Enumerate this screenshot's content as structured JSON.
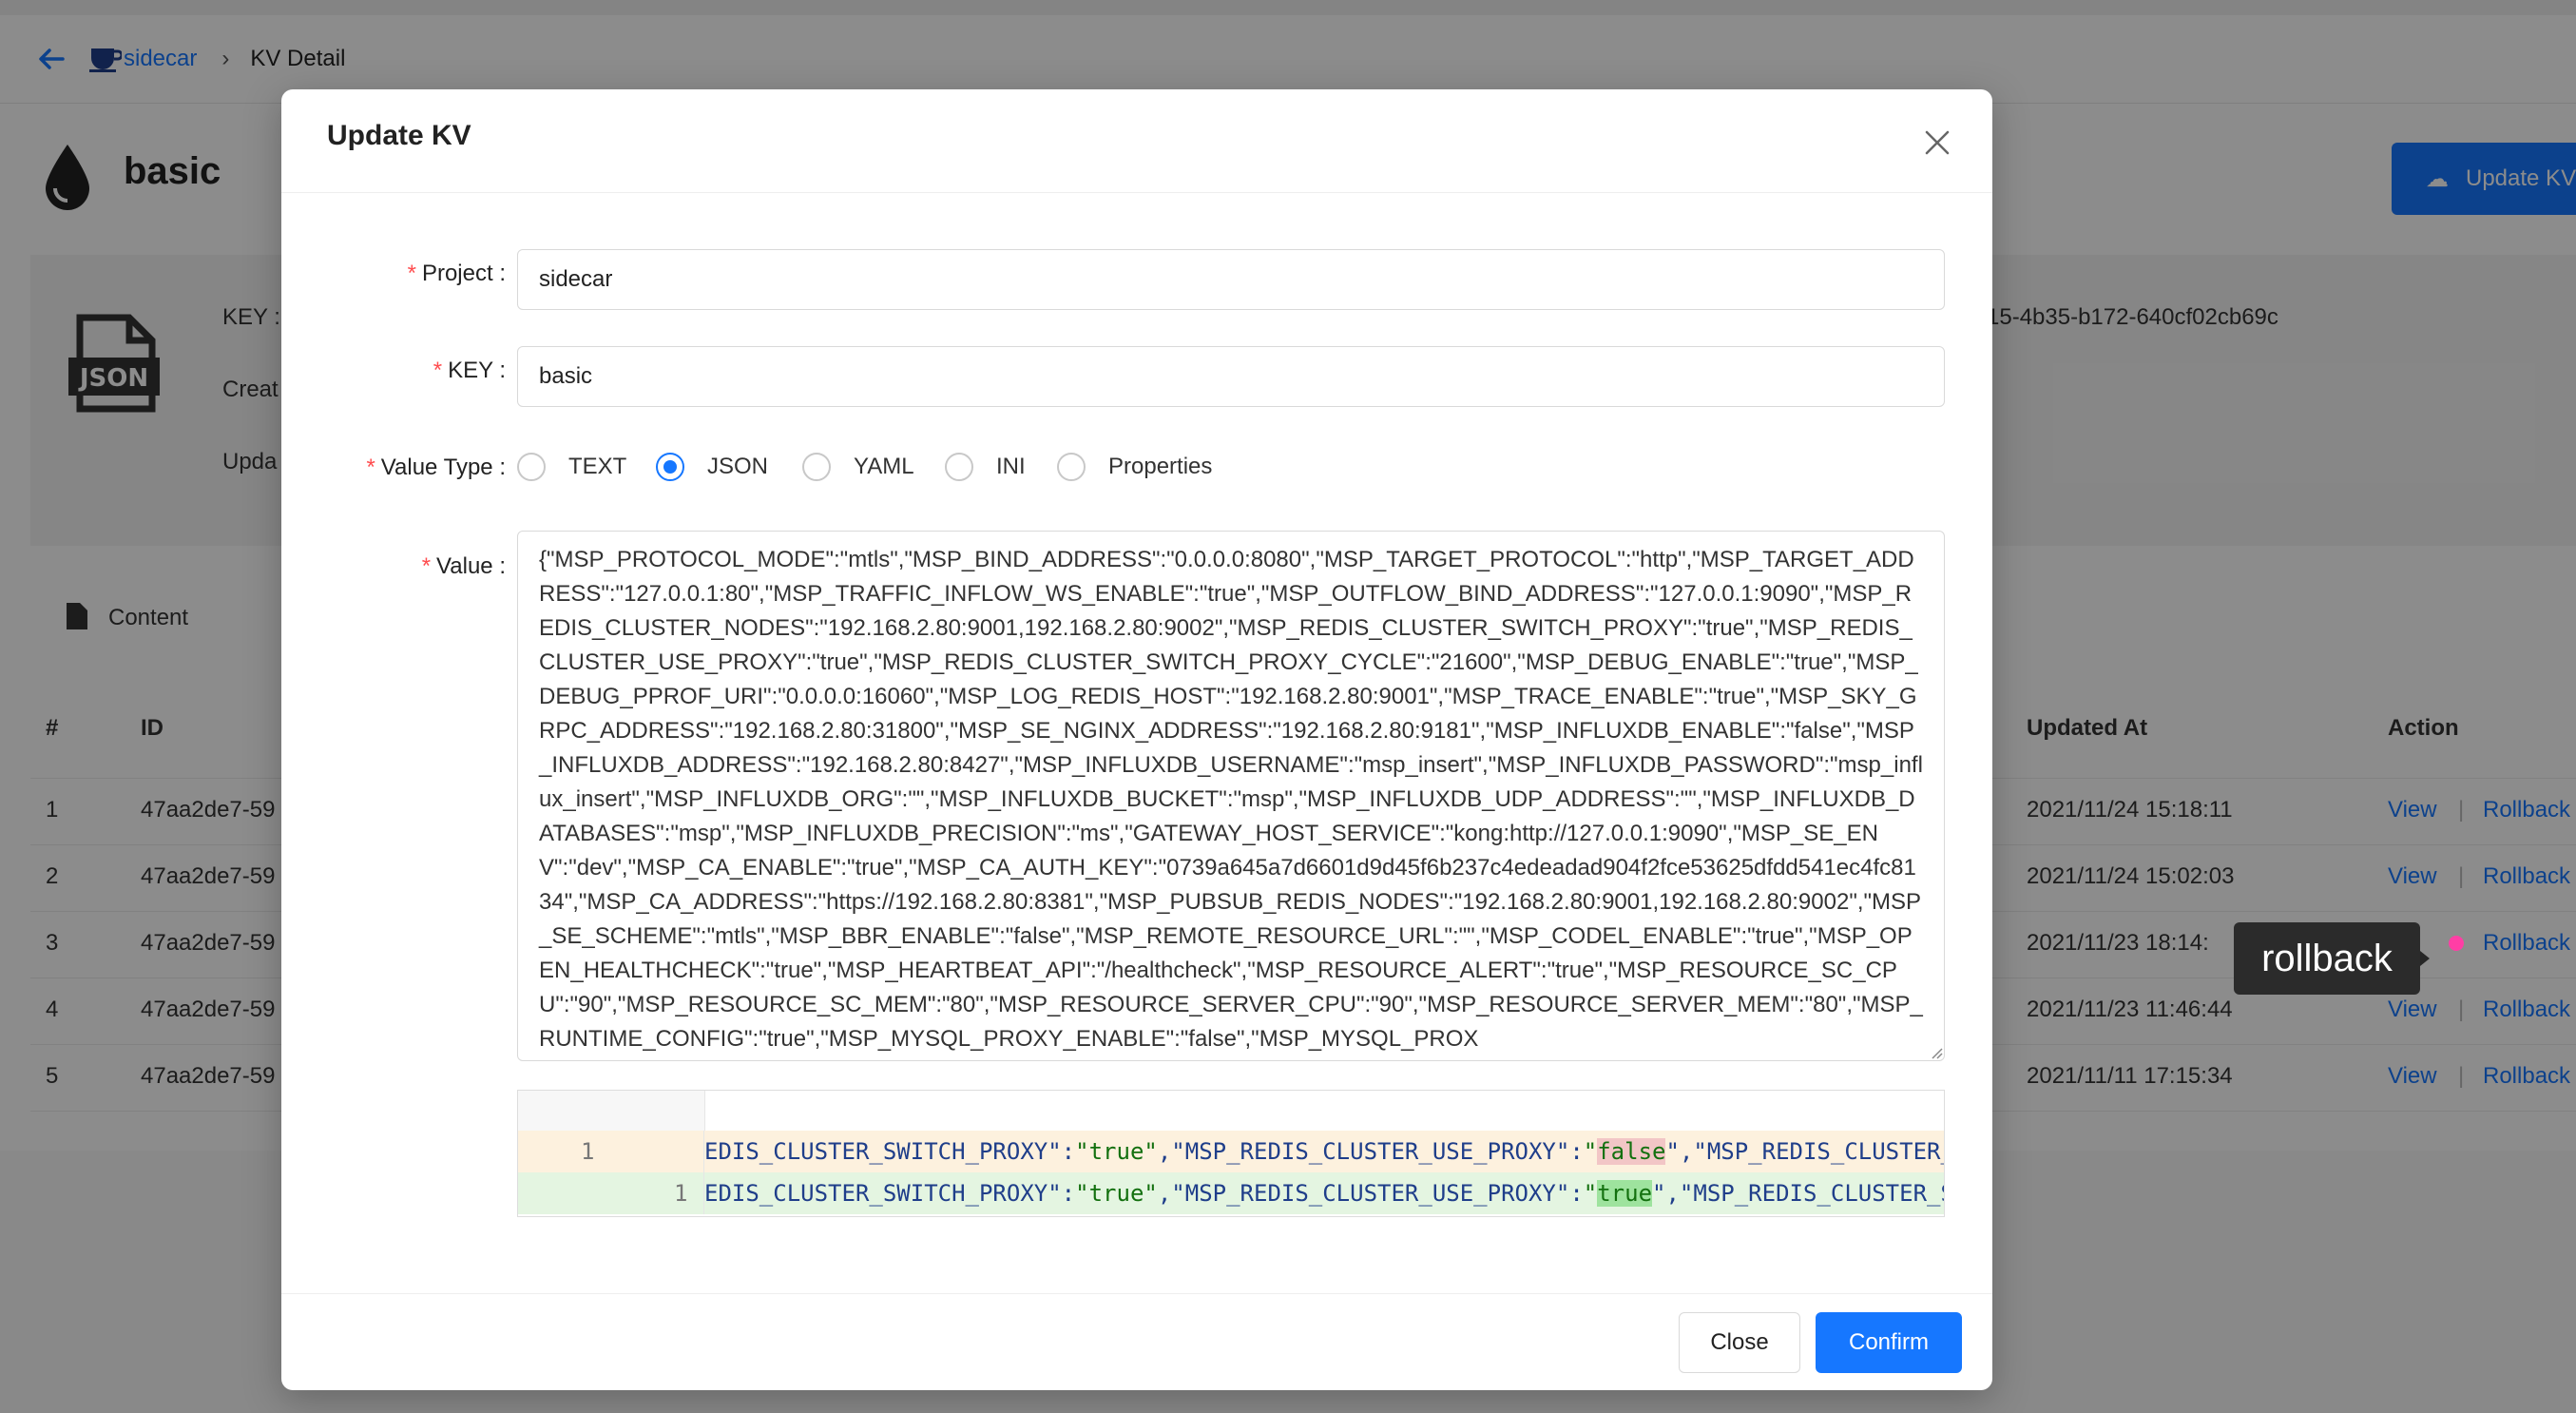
{
  "breadcrumb": {
    "project": "sidecar",
    "current": "KV Detail"
  },
  "page": {
    "title": "basic",
    "update_button": "Update KV",
    "info_key_label": "KEY :",
    "info_key_value_suffix": "15-4b35-b172-640cf02cb69c",
    "info_created_label": "Creat",
    "info_updated_label": "Upda",
    "content_tab": "Content"
  },
  "table": {
    "headers": {
      "index": "#",
      "id": "ID",
      "updated_at": "Updated At",
      "action": "Action"
    },
    "rows": [
      {
        "index": "1",
        "id": "47aa2de7-59",
        "updated_at": "2021/11/24 15:18:11",
        "view": "View",
        "rollback": "Rollback"
      },
      {
        "index": "2",
        "id": "47aa2de7-59",
        "updated_at": "2021/11/24 15:02:03",
        "view": "View",
        "rollback": "Rollback"
      },
      {
        "index": "3",
        "id": "47aa2de7-59",
        "updated_at": "2021/11/23 18:14:",
        "view": "View",
        "rollback": "Rollback"
      },
      {
        "index": "4",
        "id": "47aa2de7-59",
        "updated_at": "2021/11/23 11:46:44",
        "view": "View",
        "rollback": "Rollback"
      },
      {
        "index": "5",
        "id": "47aa2de7-59",
        "updated_at": "2021/11/11 17:15:34",
        "view": "View",
        "rollback": "Rollback"
      }
    ],
    "separator": "|"
  },
  "tooltip": "rollback",
  "modal": {
    "title": "Update KV",
    "project_label": "Project",
    "project_value": "sidecar",
    "key_label": "KEY",
    "key_value": "basic",
    "value_type_label": "Value Type",
    "value_types": [
      "TEXT",
      "JSON",
      "YAML",
      "INI",
      "Properties"
    ],
    "value_type_selected": "JSON",
    "value_label": "Value",
    "value_text": "{\"MSP_PROTOCOL_MODE\":\"mtls\",\"MSP_BIND_ADDRESS\":\"0.0.0.0:8080\",\"MSP_TARGET_PROTOCOL\":\"http\",\"MSP_TARGET_ADDRESS\":\"127.0.0.1:80\",\"MSP_TRAFFIC_INFLOW_WS_ENABLE\":\"true\",\"MSP_OUTFLOW_BIND_ADDRESS\":\"127.0.0.1:9090\",\"MSP_REDIS_CLUSTER_NODES\":\"192.168.2.80:9001,192.168.2.80:9002\",\"MSP_REDIS_CLUSTER_SWITCH_PROXY\":\"true\",\"MSP_REDIS_CLUSTER_USE_PROXY\":\"true\",\"MSP_REDIS_CLUSTER_SWITCH_PROXY_CYCLE\":\"21600\",\"MSP_DEBUG_ENABLE\":\"true\",\"MSP_DEBUG_PPROF_URI\":\"0.0.0.0:16060\",\"MSP_LOG_REDIS_HOST\":\"192.168.2.80:9001\",\"MSP_TRACE_ENABLE\":\"true\",\"MSP_SKY_GRPC_ADDRESS\":\"192.168.2.80:31800\",\"MSP_SE_NGINX_ADDRESS\":\"192.168.2.80:9181\",\"MSP_INFLUXDB_ENABLE\":\"false\",\"MSP_INFLUXDB_ADDRESS\":\"192.168.2.80:8427\",\"MSP_INFLUXDB_USERNAME\":\"msp_insert\",\"MSP_INFLUXDB_PASSWORD\":\"msp_influx_insert\",\"MSP_INFLUXDB_ORG\":\"\",\"MSP_INFLUXDB_BUCKET\":\"msp\",\"MSP_INFLUXDB_UDP_ADDRESS\":\"\",\"MSP_INFLUXDB_DATABASES\":\"msp\",\"MSP_INFLUXDB_PRECISION\":\"ms\",\"GATEWAY_HOST_SERVICE\":\"kong:http://127.0.0.1:9090\",\"MSP_SE_ENV\":\"dev\",\"MSP_CA_ENABLE\":\"true\",\"MSP_CA_AUTH_KEY\":\"0739a645a7d6601d9d45f6b237c4edeadad904f2fce53625dfdd541ec4fc8134\",\"MSP_CA_ADDRESS\":\"https://192.168.2.80:8381\",\"MSP_PUBSUB_REDIS_NODES\":\"192.168.2.80:9001,192.168.2.80:9002\",\"MSP_SE_SCHEME\":\"mtls\",\"MSP_BBR_ENABLE\":\"false\",\"MSP_REMOTE_RESOURCE_URL\":\"\",\"MSP_CODEL_ENABLE\":\"true\",\"MSP_OPEN_HEALTHCHECK\":\"true\",\"MSP_HEARTBEAT_API\":\"/healthcheck\",\"MSP_RESOURCE_ALERT\":\"true\",\"MSP_RESOURCE_SC_CPU\":\"90\",\"MSP_RESOURCE_SC_MEM\":\"80\",\"MSP_RESOURCE_SERVER_CPU\":\"90\",\"MSP_RESOURCE_SERVER_MEM\":\"80\",\"MSP_RUNTIME_CONFIG\":\"true\",\"MSP_MYSQL_PROXY_ENABLE\":\"false\",\"MSP_MYSQL_PROX",
    "diff": {
      "old_line_no": "1",
      "new_line_no": "1",
      "prefix": "EDIS_CLUSTER_SWITCH_PROXY\":",
      "prefix_val": "\"true\"",
      "mid_key": ",\"MSP_REDIS_CLUSTER_USE_PROXY\":",
      "old_val": "false",
      "new_val": "true",
      "old_tail": "\",\"MSP_REDIS_CLUSTER_",
      "new_tail": "\",\"MSP_REDIS_CLUSTER_S"
    },
    "close_button": "Close",
    "confirm_button": "Confirm"
  },
  "colors": {
    "primary": "#1677ff",
    "required": "#ff4d4f",
    "diff_del": "#fdf1de",
    "diff_add": "#e4f5e1",
    "tooltip_dot": "#ff3ea5"
  }
}
